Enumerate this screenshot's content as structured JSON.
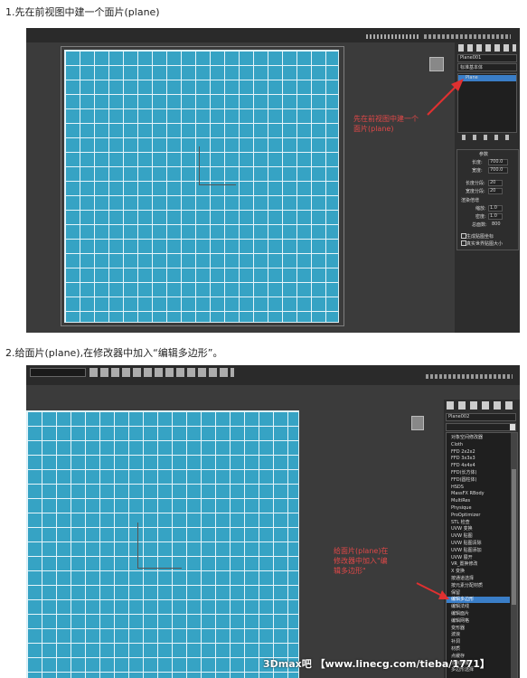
{
  "step1": {
    "caption": "1.先在前视图中建一个面片(plane)",
    "object_name": "Plane001",
    "type_dropdown": "标准基本体",
    "modifier_item": "Plane",
    "annotation": "先在前视图中建一个\n面片(plane)",
    "params": {
      "rollout_title": "参数",
      "length_label": "长度:",
      "length_value": "700.0",
      "width_label": "宽度:",
      "width_value": "700.0",
      "length_segs_label": "长度分段:",
      "length_segs_value": "20",
      "width_segs_label": "宽度分段:",
      "width_segs_value": "20",
      "render_section": "渲染倍增",
      "scale_label": "缩放:",
      "scale_value": "1.0",
      "density_label": "密度:",
      "density_value": "1.0",
      "total_faces_label": "总面数:",
      "total_faces_value": "800",
      "check_mapping": "生成贴图坐标",
      "check_realworld": "真实世界贴图大小"
    }
  },
  "step2": {
    "caption": "2.给面片(plane),在修改器中加入“编辑多边形”。",
    "object_name": "Plane002",
    "annotation": "给面片(plane)在\n修改器中加入\"编\n辑多边形\"",
    "modifier_list": [
      "对象空间修改器",
      "Cloth",
      "FFD 2x2x2",
      "FFD 3x3x3",
      "FFD 4x4x4",
      "FFD(长方体)",
      "FFD(圆柱体)",
      "HSDS",
      "MassFX RBody",
      "MultiRes",
      "Physique",
      "ProOptimizer",
      "STL 检查",
      "UVW 变换",
      "UVW 贴图",
      "UVW 贴图清除",
      "UVW 贴图添加",
      "UVW 展开",
      "VR_置换修改",
      "X 变换",
      "按通道选择",
      "按元素分配材质",
      "保留",
      "编辑多边形",
      "编辑法线",
      "编辑面片",
      "编辑网格",
      "变形器",
      "波浪",
      "补洞",
      "材质",
      "点缓存",
      "顶点焊接",
      "多边形选择"
    ],
    "selected_index": 23,
    "watermark": "3Dmax吧 【www.linecg.com/tieba/1771】"
  }
}
